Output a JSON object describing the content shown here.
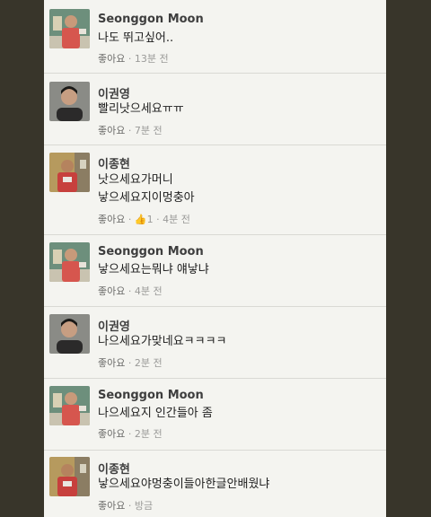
{
  "comments": [
    {
      "name": "Seonggon Moon",
      "lines": [
        "나도 뛰고싶어.."
      ],
      "like": "좋아요",
      "sep": " · ",
      "time": "13분 전",
      "avatar_kind": "red-shirt"
    },
    {
      "name": "이권영",
      "lines": [
        "빨리낫으세요ㅠㅠ"
      ],
      "like": "좋아요",
      "sep": " · ",
      "time": "7분 전",
      "avatar_kind": "portrait"
    },
    {
      "name": "이종현",
      "lines": [
        "낫으세요가머니",
        "낳으세요지이멍충아"
      ],
      "like": "좋아요",
      "sep": " · ",
      "likes": "1",
      "time": "4분 전",
      "avatar_kind": "jersey"
    },
    {
      "name": "Seonggon Moon",
      "lines": [
        "낳으세요는뭐냐 얘낳냐"
      ],
      "like": "좋아요",
      "sep": " · ",
      "time": "4분 전",
      "avatar_kind": "red-shirt"
    },
    {
      "name": "이권영",
      "lines": [
        "나으세요가맞네요ㅋㅋㅋㅋ"
      ],
      "like": "좋아요",
      "sep": " · ",
      "time": "2분 전",
      "avatar_kind": "portrait"
    },
    {
      "name": "Seonggon Moon",
      "lines": [
        "나으세요지 인간들아 좀"
      ],
      "like": "좋아요",
      "sep": " · ",
      "time": "2분 전",
      "avatar_kind": "red-shirt"
    },
    {
      "name": "이종현",
      "lines": [
        "낳으세요야멍충이들아한글안배웠냐"
      ],
      "like": "좋아요",
      "sep": " · ",
      "time": "방금",
      "avatar_kind": "jersey"
    }
  ],
  "icons": {
    "thumb": "thumbs-up-icon"
  },
  "colors": {
    "background": "#38352a",
    "panel": "#f4f4f0",
    "accent": "#4a67a6"
  }
}
